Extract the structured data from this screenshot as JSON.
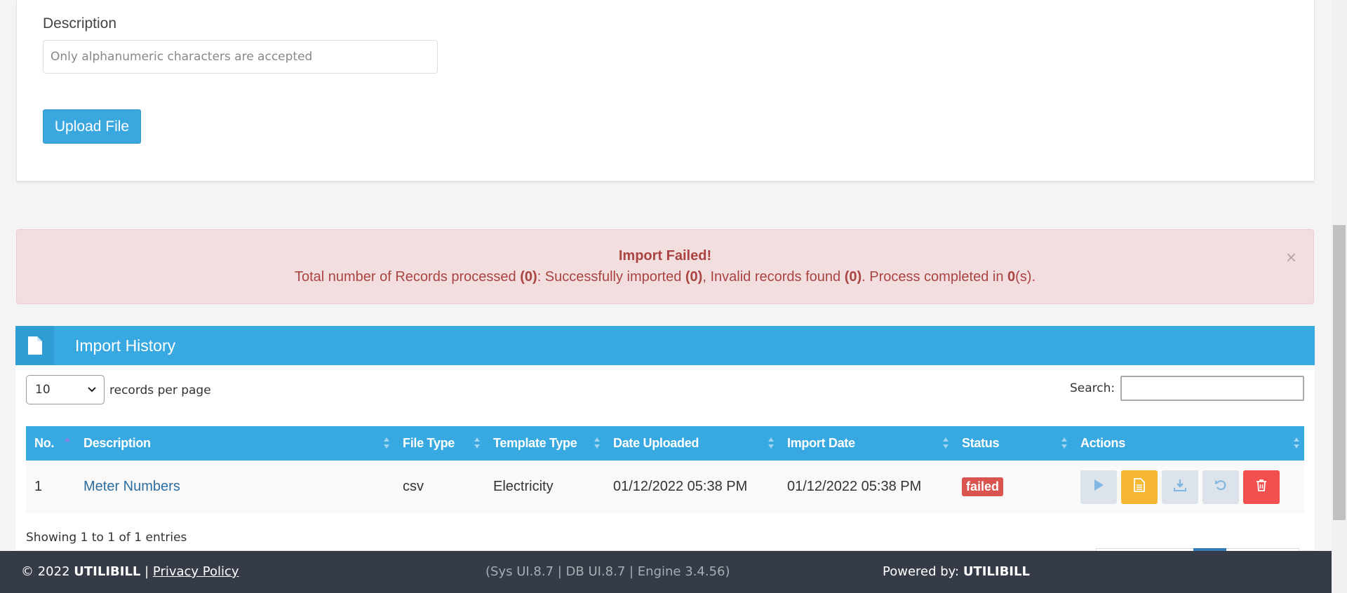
{
  "upload_form": {
    "description_label": "Description",
    "description_placeholder": "Only alphanumeric characters are accepted",
    "upload_button": "Upload File"
  },
  "alert": {
    "title": "Import Failed!",
    "text_prefix": "Total number of Records processed ",
    "processed": "(0)",
    "text_imported": ": Successfully imported ",
    "imported": "(0)",
    "text_invalid": ", Invalid records found ",
    "invalid": "(0)",
    "text_completed": ". Process completed in ",
    "seconds": "0",
    "text_suffix": "(s).",
    "close": "×"
  },
  "import_history": {
    "title": "Import History",
    "length_value": "10",
    "length_label": "records per page",
    "search_label": "Search:",
    "columns": [
      "No.",
      "Description",
      "File Type",
      "Template Type",
      "Date Uploaded",
      "Import Date",
      "Status",
      "Actions"
    ],
    "rows": [
      {
        "no": "1",
        "description": "Meter Numbers",
        "file_type": "csv",
        "template_type": "Electricity",
        "date_uploaded": "01/12/2022 05:38 PM",
        "import_date": "01/12/2022 05:38 PM",
        "status": "failed"
      }
    ],
    "showing": "Showing 1 to 1 of 1 entries"
  },
  "footer": {
    "copyright": "© 2022 ",
    "brand": "UTILIBILL",
    "separator": " | ",
    "privacy": "Privacy Policy",
    "versions": "(Sys UI.8.7 | DB UI.8.7 | Engine 3.4.56)",
    "powered_label": "Powered by: ",
    "powered_brand": "UTILIBILL"
  },
  "colors": {
    "primary": "#38a9e0",
    "alert_bg": "#f2dede",
    "alert_text": "#a94442",
    "danger": "#d9534f",
    "warning": "#f5b731",
    "footer_bg": "#353c47"
  },
  "icons": [
    "file-icon",
    "close-icon",
    "chevron-down-icon",
    "sort-icon",
    "play-icon",
    "document-icon",
    "download-icon",
    "undo-icon",
    "trash-icon"
  ]
}
